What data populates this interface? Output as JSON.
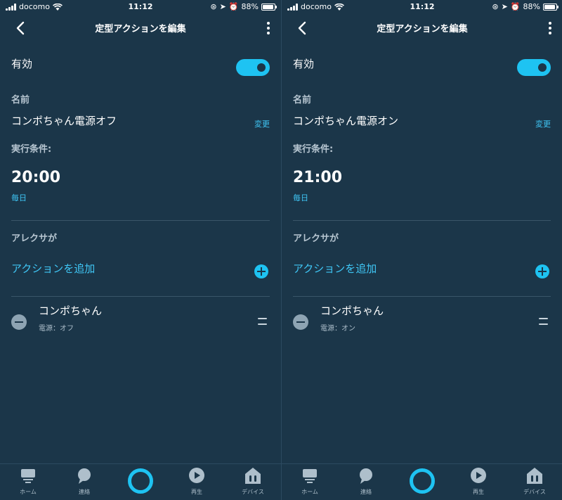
{
  "panels": [
    {
      "status": {
        "carrier": "docomo",
        "time": "11:12",
        "battery": "88%"
      },
      "nav": {
        "title": "定型アクションを編集"
      },
      "enabled": {
        "label": "有効",
        "on": true
      },
      "name": {
        "label": "名前",
        "value": "コンポちゃん電源オフ",
        "change": "変更"
      },
      "condition": {
        "label": "実行条件:",
        "time": "20:00",
        "repeat": "毎日"
      },
      "alexa": {
        "label": "アレクサが",
        "add_action": "アクションを追加"
      },
      "action": {
        "title": "コンポちゃん",
        "subtitle": "電源：オフ"
      },
      "tabs": {
        "home": "ホーム",
        "communicate": "連絡",
        "play": "再生",
        "devices": "デバイス"
      }
    },
    {
      "status": {
        "carrier": "docomo",
        "time": "11:12",
        "battery": "88%"
      },
      "nav": {
        "title": "定型アクションを編集"
      },
      "enabled": {
        "label": "有効",
        "on": true
      },
      "name": {
        "label": "名前",
        "value": "コンポちゃん電源オン",
        "change": "変更"
      },
      "condition": {
        "label": "実行条件:",
        "time": "21:00",
        "repeat": "毎日"
      },
      "alexa": {
        "label": "アレクサが",
        "add_action": "アクションを追加"
      },
      "action": {
        "title": "コンポちゃん",
        "subtitle": "電源：オン"
      },
      "tabs": {
        "home": "ホーム",
        "communicate": "連絡",
        "play": "再生",
        "devices": "デバイス"
      }
    }
  ],
  "colors": {
    "background": "#1b3649",
    "accent": "#1ec3f2",
    "link": "#3fc6f5",
    "muted": "#b7c6d1"
  },
  "battery_level": 0.88
}
